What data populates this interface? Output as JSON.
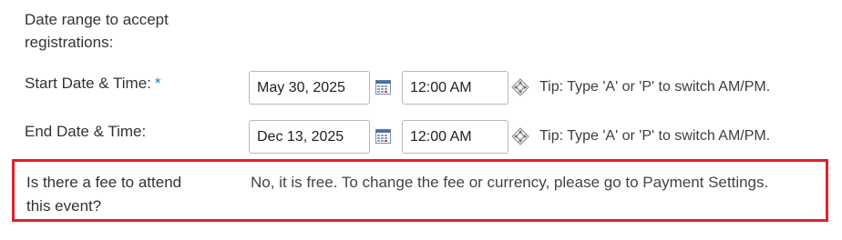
{
  "date_range": {
    "label_line1": "Date range to accept",
    "label_line2": "registrations:"
  },
  "start": {
    "label": "Start Date & Time:",
    "required_mark": "*",
    "date_value": "May 30, 2025",
    "time_value": "12:00 AM",
    "tip": "Tip: Type 'A' or 'P' to switch AM/PM."
  },
  "end": {
    "label": "End Date & Time:",
    "date_value": "Dec 13, 2025",
    "time_value": "12:00 AM",
    "tip": "Tip: Type 'A' or 'P' to switch AM/PM."
  },
  "fee": {
    "label_line1": "Is there a fee to attend",
    "label_line2": "this event?",
    "text": "No, it is free. To change the fee or currency, please go to Payment Settings."
  },
  "icons": {
    "calendar": "calendar-icon",
    "time_toggle": "time-spinner-icon"
  },
  "colors": {
    "required": "#1f7fc4",
    "highlight_border": "#e0202a"
  }
}
